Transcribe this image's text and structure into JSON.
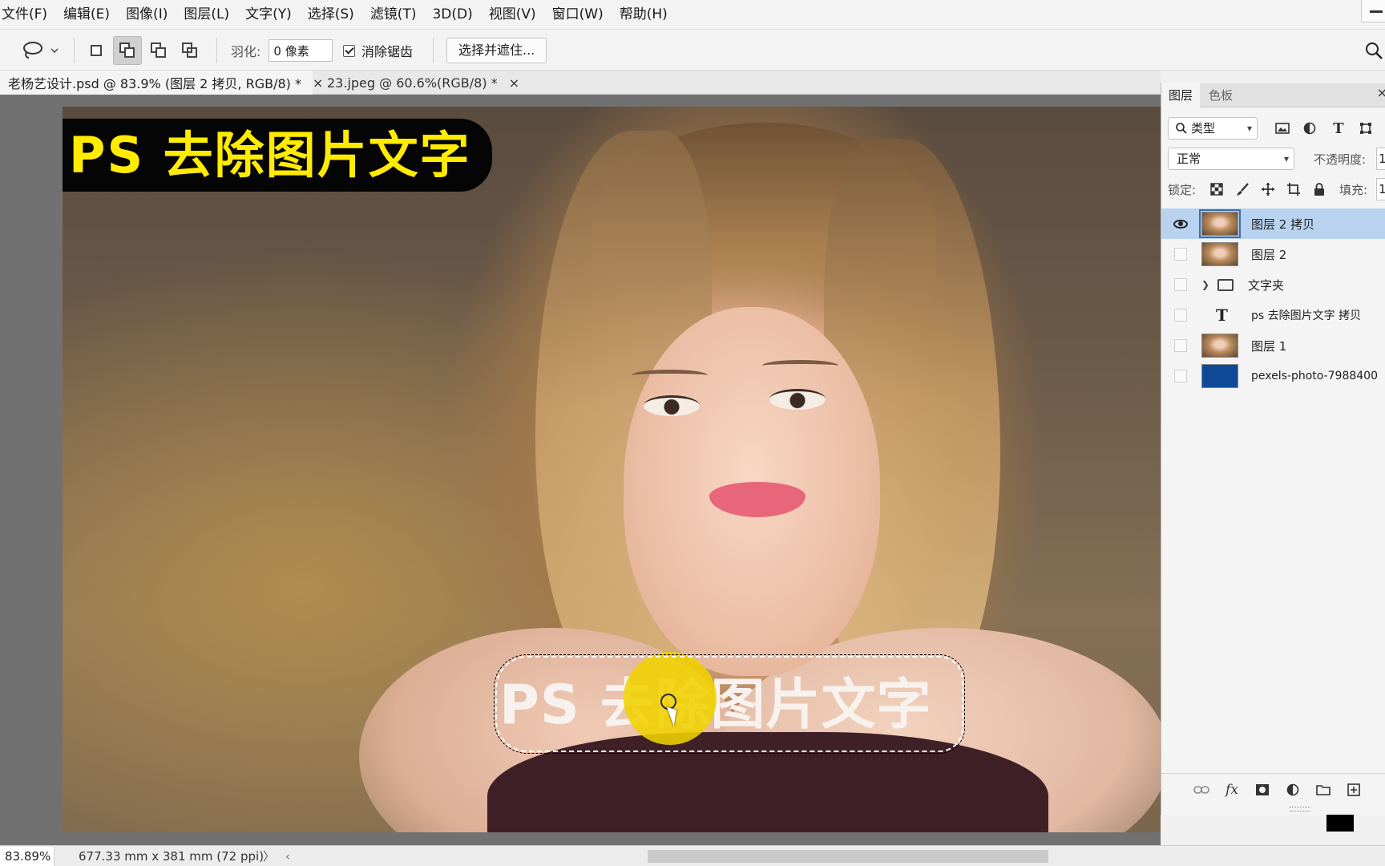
{
  "menu": [
    "文件(F)",
    "编辑(E)",
    "图像(I)",
    "图层(L)",
    "文字(Y)",
    "选择(S)",
    "滤镜(T)",
    "3D(D)",
    "视图(V)",
    "窗口(W)",
    "帮助(H)"
  ],
  "options": {
    "feather_label": "羽化:",
    "feather_value": "0 像素",
    "antialias_label": "消除锯齿",
    "select_mask_button": "选择并遮住..."
  },
  "tabs": [
    {
      "label": "老杨艺设计.psd @ 83.9% (图层 2 拷贝, RGB/8) *",
      "close": "×"
    },
    {
      "label": "23.jpeg @ 60.6%(RGB/8) *",
      "close": "×"
    }
  ],
  "canvas": {
    "title_text": "PS 去除图片文字",
    "bottom_text": "PS 去除图片文字"
  },
  "status": {
    "zoom": "83.89%",
    "doc_info": "677.33 mm x 381 mm (72 ppi)",
    "more_arrow": "〉",
    "scroll_left": "‹"
  },
  "layers_panel": {
    "tabs": [
      "图层",
      "色板"
    ],
    "close": "×",
    "filter_kind": "类型",
    "blend_mode": "正常",
    "opacity_label": "不透明度:",
    "opacity_value": "1",
    "lock_label": "锁定:",
    "fill_label": "填充:",
    "fill_value": "1",
    "layers": [
      {
        "name": "图层 2 拷贝",
        "thumb": "photo",
        "visible": true,
        "selected": true
      },
      {
        "name": "图层 2",
        "thumb": "photo",
        "visible": false,
        "selected": false
      },
      {
        "name": "文字夹",
        "thumb": "folder",
        "visible": false,
        "selected": false
      },
      {
        "name": "ps 去除图片文字 拷贝",
        "thumb": "type",
        "visible": false,
        "selected": false
      },
      {
        "name": "图层 1",
        "thumb": "photo",
        "visible": false,
        "selected": false
      },
      {
        "name": "pexels-photo-7988400",
        "thumb": "blue",
        "visible": false,
        "selected": false
      }
    ]
  },
  "colors": {
    "title_yellow": "#ffec00",
    "selected_layer": "#b8d3ef",
    "cursor_highlight": "#f0d200"
  }
}
